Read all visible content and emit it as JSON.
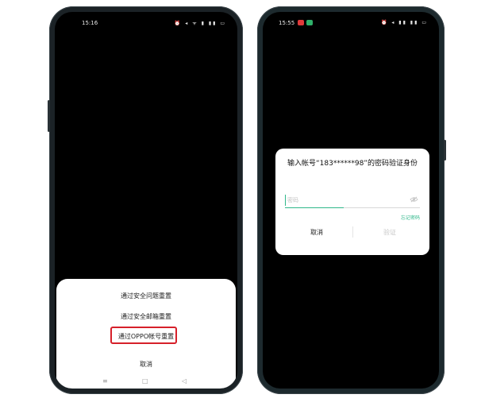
{
  "left_phone": {
    "status": {
      "time": "15:16",
      "icons": "⏰ ◂ ᯤ ▮ ▮▮ ▭"
    },
    "sheet": {
      "options": [
        "通过安全问题重置",
        "通过安全邮箱重置",
        "通过OPPO帐号重置",
        "取消"
      ]
    },
    "nav": {
      "menu": "≡",
      "home": "□",
      "back": "◁"
    }
  },
  "right_phone": {
    "status": {
      "time": "15:55",
      "icons": "⏰ ◂ ▮▮ ▮▮ ▭"
    },
    "dialog": {
      "title": "输入帐号“183******98”的密码验证身份",
      "password_placeholder": "密码",
      "forgot": "忘记密码",
      "cancel": "取消",
      "verify": "验证"
    }
  },
  "colors": {
    "accent_green": "#2fb78a",
    "highlight_red": "#d6202a"
  }
}
